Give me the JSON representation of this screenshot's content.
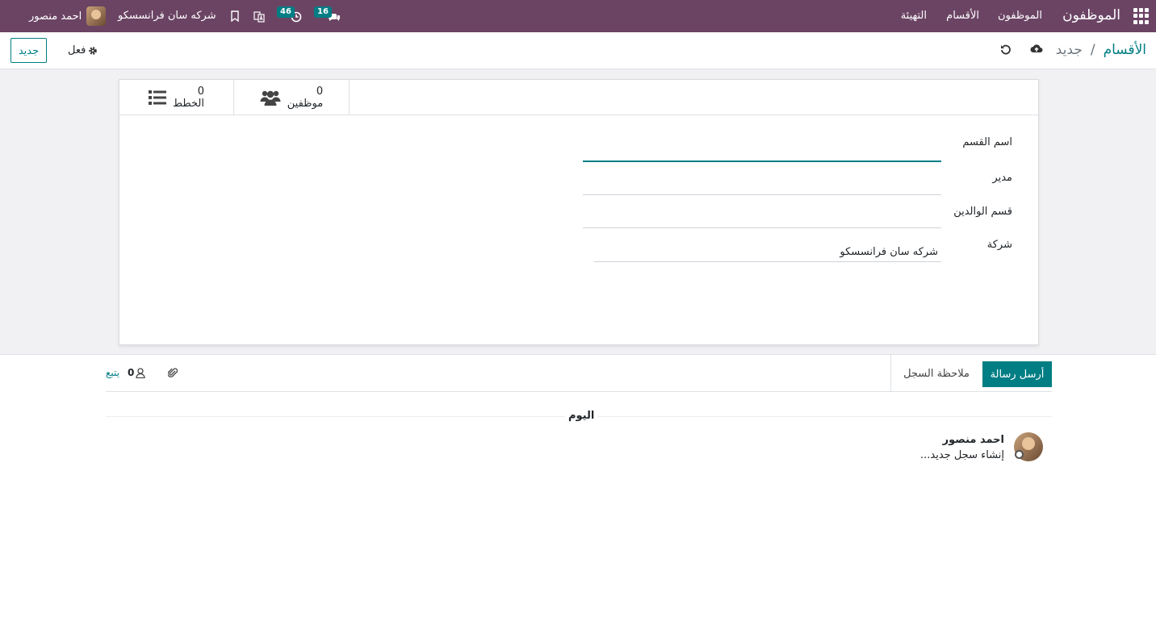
{
  "navbar": {
    "brand": "الموظفون",
    "menu": [
      "الموظفون",
      "الأقسام",
      "التهيئة"
    ],
    "messages_badge": "16",
    "activities_badge": "46",
    "company": "شركه سان فرانسسكو",
    "user": "احمد منصور"
  },
  "control_panel": {
    "new_label": "جديد",
    "action_label": "فعل",
    "breadcrumb_parent": "الأقسام",
    "breadcrumb_separator": "/",
    "breadcrumb_current": "جديد"
  },
  "form": {
    "stat_buttons": [
      {
        "value": "0",
        "label": "موظفين",
        "icon": "users-icon"
      },
      {
        "value": "0",
        "label": "الخطط",
        "icon": "list-icon"
      }
    ],
    "fields": {
      "name": {
        "label": "اسم القسم",
        "value": ""
      },
      "manager": {
        "label": "مدير",
        "value": ""
      },
      "parent": {
        "label": "قسم الوالدين",
        "value": ""
      },
      "company": {
        "label": "شركة",
        "value": "شركه سان فرانسسكو"
      }
    }
  },
  "chatter": {
    "send_label": "أرسل رسالة",
    "log_label": "ملاحظة السجل",
    "followers_count": "0",
    "follow_label": "يتبع",
    "date_label": "اليوم",
    "message": {
      "author": "احمد منصور",
      "text": "إنشاء سجل جديد..."
    }
  },
  "colors": {
    "navbar": "#6b4464",
    "primary": "#017e84"
  }
}
